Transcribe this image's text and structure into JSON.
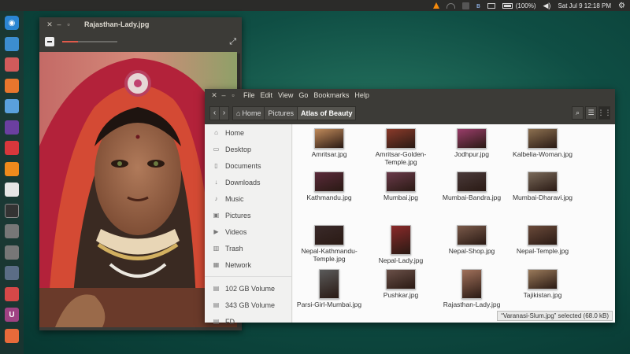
{
  "top_panel": {
    "icons": [
      "vlc-icon",
      "wifi-icon",
      "app-indicator-icon",
      "bluetooth-icon",
      "mail-icon",
      "battery-icon",
      "volume-icon",
      "gear-icon"
    ],
    "battery_text": "(100%)",
    "datetime": "Sat Jul  9 12:18 PM"
  },
  "launcher": {
    "items": [
      {
        "name": "ubuntu-dash-icon",
        "color": "#2b86d3",
        "glyph": "◉"
      },
      {
        "name": "files-icon",
        "color": "#3c8ed0",
        "glyph": ""
      },
      {
        "name": "archive-manager-icon",
        "color": "#d15b5b",
        "glyph": ""
      },
      {
        "name": "firefox-icon",
        "color": "#e8762d",
        "glyph": ""
      },
      {
        "name": "chromium-icon",
        "color": "#5aa0dd",
        "glyph": ""
      },
      {
        "name": "tor-browser-icon",
        "color": "#6b3fa0",
        "glyph": ""
      },
      {
        "name": "dice-app-icon",
        "color": "#d9373c",
        "glyph": ""
      },
      {
        "name": "vlc-icon",
        "color": "#f08a1c",
        "glyph": ""
      },
      {
        "name": "text-editor-icon",
        "color": "#e6e6e6",
        "glyph": ""
      },
      {
        "name": "terminal-icon",
        "color": "#333333",
        "glyph": ""
      },
      {
        "name": "disk-icon",
        "color": "#777777",
        "glyph": ""
      },
      {
        "name": "disk-icon",
        "color": "#777777",
        "glyph": ""
      },
      {
        "name": "drive-icon",
        "color": "#5b6d86",
        "glyph": ""
      },
      {
        "name": "document-viewer-icon",
        "color": "#d54848",
        "glyph": ""
      },
      {
        "name": "ubuntu-one-icon",
        "color": "#a04283",
        "glyph": "U"
      },
      {
        "name": "system-settings-icon",
        "color": "#e86a3a",
        "glyph": ""
      }
    ]
  },
  "viewer": {
    "title": "Rajasthan-Lady.jpg",
    "zoom_level": 0.28
  },
  "files": {
    "menus": [
      "File",
      "Edit",
      "View",
      "Go",
      "Bookmarks",
      "Help"
    ],
    "breadcrumbs": [
      {
        "label": "Home"
      },
      {
        "label": "Pictures"
      },
      {
        "label": "Atlas of Beauty"
      }
    ],
    "sidebar": [
      {
        "label": "Home",
        "icon": "home-icon",
        "glyph": "⌂"
      },
      {
        "label": "Desktop",
        "icon": "desktop-icon",
        "glyph": "▭"
      },
      {
        "label": "Documents",
        "icon": "documents-icon",
        "glyph": "▯"
      },
      {
        "label": "Downloads",
        "icon": "downloads-icon",
        "glyph": "↓"
      },
      {
        "label": "Music",
        "icon": "music-icon",
        "glyph": "♪"
      },
      {
        "label": "Pictures",
        "icon": "pictures-icon",
        "glyph": "▣"
      },
      {
        "label": "Videos",
        "icon": "videos-icon",
        "glyph": "▶"
      },
      {
        "label": "Trash",
        "icon": "trash-icon",
        "glyph": "▥"
      },
      {
        "label": "Network",
        "icon": "network-icon",
        "glyph": "▦"
      }
    ],
    "volumes": [
      {
        "label": "102 GB Volume",
        "icon": "drive-icon",
        "glyph": "▤"
      },
      {
        "label": "343 GB Volume",
        "icon": "drive-icon",
        "glyph": "▤"
      },
      {
        "label": "FD",
        "icon": "drive-icon",
        "glyph": "▤"
      }
    ],
    "items": [
      {
        "name": "Amritsar.jpg",
        "thumb": "#c08a5a"
      },
      {
        "name": "Amritsar-Golden-Temple.jpg",
        "thumb": "#8a3a2a"
      },
      {
        "name": "Jodhpur.jpg",
        "thumb": "#9a3d6a"
      },
      {
        "name": "Kalbelia-Woman.jpg",
        "thumb": "#8c7050"
      },
      {
        "name": "Kathmandu.jpg",
        "thumb": "#5a2a3a"
      },
      {
        "name": "Mumbai.jpg",
        "thumb": "#6a3a4a"
      },
      {
        "name": "Mumbai-Bandra.jpg",
        "thumb": "#4a3a3a"
      },
      {
        "name": "Mumbai-Dharavi.jpg",
        "thumb": "#7a6a5a"
      },
      {
        "name": "Nepal-Kathmandu-Temple.jpg",
        "thumb": "#3a2a2a"
      },
      {
        "name": "Nepal-Lady.jpg",
        "thumb": "#8a2a2a"
      },
      {
        "name": "Nepal-Shop.jpg",
        "thumb": "#7a5a4a"
      },
      {
        "name": "Nepal-Temple.jpg",
        "thumb": "#6a4a3a"
      },
      {
        "name": "Parsi-Girl-Mumbai.jpg",
        "thumb": "#5a5a5a"
      },
      {
        "name": "Pushkar.jpg",
        "thumb": "#6a5048"
      },
      {
        "name": "Rajasthan-Lady.jpg",
        "thumb": "#a0705a"
      },
      {
        "name": "Tajikistan.jpg",
        "thumb": "#9a7a5a"
      }
    ],
    "status": "“Varanasi-Slum.jpg” selected  (68.0 kB)"
  }
}
